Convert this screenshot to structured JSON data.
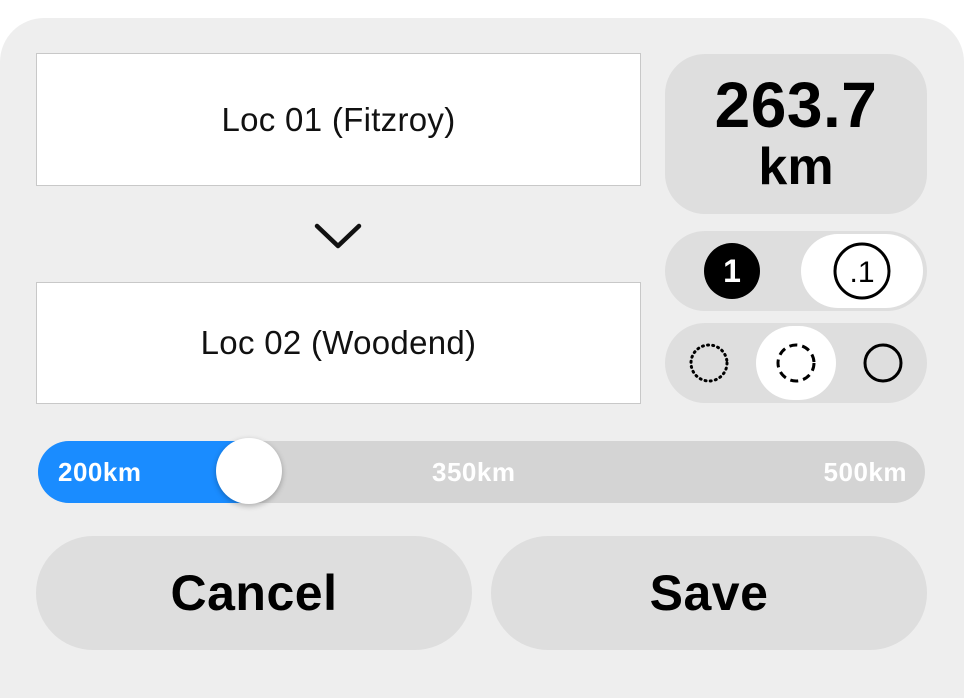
{
  "route": {
    "from_label": "Loc 01 (Fitzroy)",
    "to_label": "Loc 02 (Woodend)",
    "direction_icon": "chevron-down-icon"
  },
  "distance": {
    "value": "263.7",
    "unit": "km"
  },
  "precision_selector": {
    "options": [
      {
        "name": "whole-number",
        "icon": "filled-circle-1-icon",
        "glyph": "1",
        "selected": false
      },
      {
        "name": "one-decimal",
        "icon": "outlined-circle-point-1-icon",
        "glyph": ".1",
        "selected": true
      }
    ]
  },
  "line_style_selector": {
    "options": [
      {
        "name": "dotted",
        "icon": "dotted-circle-icon",
        "selected": false
      },
      {
        "name": "dashed",
        "icon": "dashed-circle-icon",
        "selected": true
      },
      {
        "name": "solid",
        "icon": "solid-circle-icon",
        "selected": false
      }
    ]
  },
  "range_slider": {
    "min_label": "200km",
    "mid_label": "350km",
    "max_label": "500km",
    "min": 200,
    "max": 500,
    "value": 263.7,
    "fill_color": "#1a8cff"
  },
  "actions": {
    "cancel_label": "Cancel",
    "save_label": "Save"
  },
  "colors": {
    "accent": "#1a8cff",
    "panel_bg": "#eeeeee",
    "control_bg": "#dedede"
  }
}
